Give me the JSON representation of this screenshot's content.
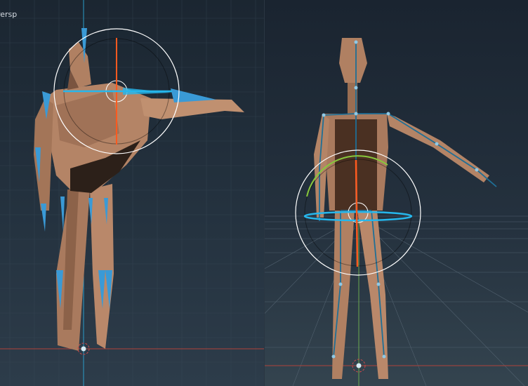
{
  "viewports": {
    "left": {
      "label": "Persp"
    },
    "right": {
      "label": ""
    }
  },
  "colors": {
    "background": "#1e2a36",
    "grid": "#3a4a58",
    "axis_red": "#c0392b",
    "axis_green": "#6aa84f",
    "axis_blue": "#2aa7d6",
    "skin": "#b08062",
    "skin_dark": "#2a1e18",
    "bone": "#3ab4e6",
    "gizmo_ring": "#ffffff",
    "gizmo_z": "#ff5a1f",
    "gizmo_y": "#88c83c",
    "gizmo_x": "#26b7ec"
  },
  "icons": [
    "root-marker-icon",
    "transform-gizmo-icon"
  ]
}
